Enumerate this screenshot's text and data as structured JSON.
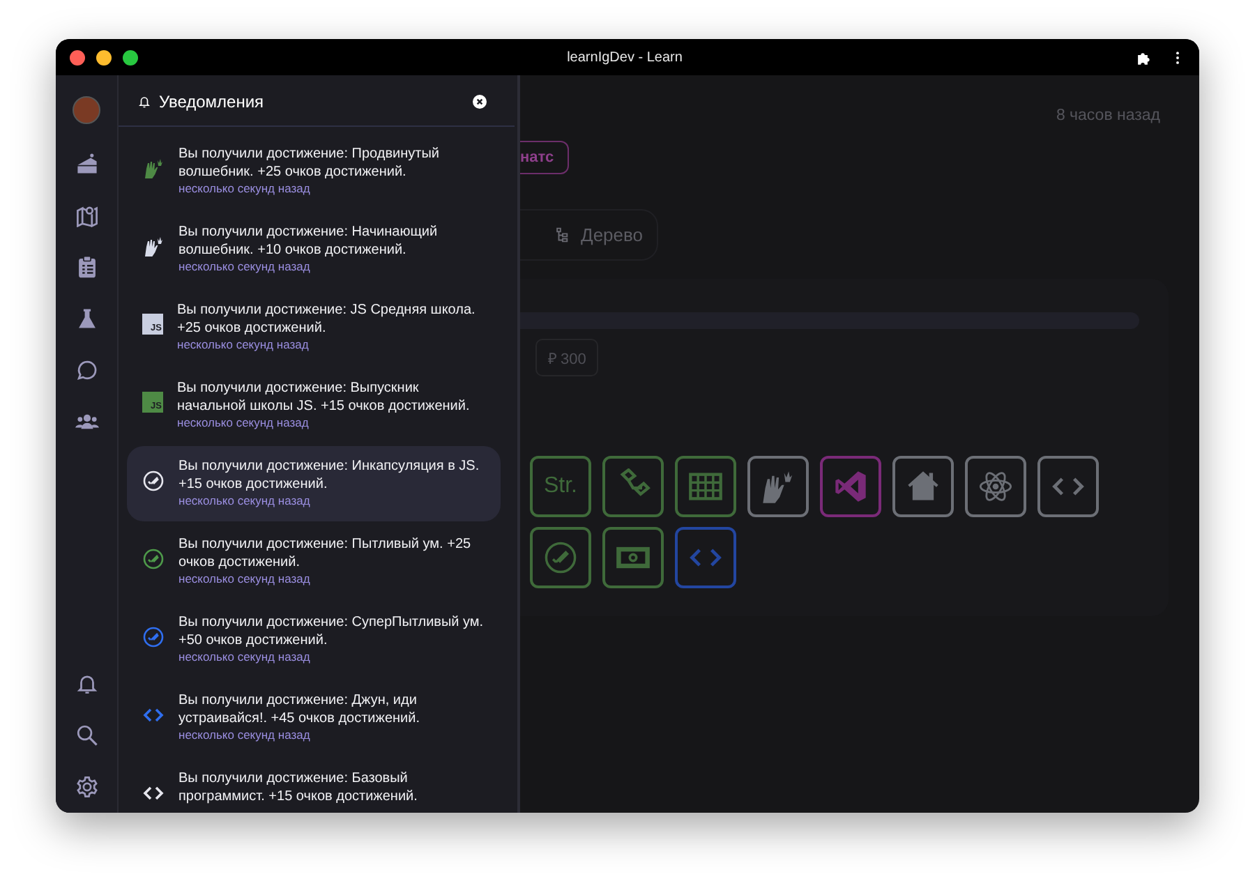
{
  "window": {
    "title": "learnIgDev - Learn"
  },
  "notifications": {
    "title": "Уведомления",
    "items": [
      {
        "kind": "hand",
        "color": "#4e8a45",
        "text": "Вы получили достижение: Продвинутый волшебник. +25 очков достижений.",
        "time": "несколько секунд назад",
        "selected": false
      },
      {
        "kind": "hand",
        "color": "#d8dcea",
        "text": "Вы получили достижение: Начинающий волшебник. +10 очков достижений.",
        "time": "несколько секунд назад",
        "selected": false
      },
      {
        "kind": "logo",
        "logo": "JS",
        "color": "#c9cee0",
        "text": "Вы получили достижение: JS Средняя школа. +25 очков достижений.",
        "time": "несколько секунд назад",
        "selected": false
      },
      {
        "kind": "logo",
        "logo": "JS",
        "color": "#4e8a45",
        "text": "Вы получили достижение: Выпускник начальной школы JS. +15 очков достижений.",
        "time": "несколько секунд назад",
        "selected": false
      },
      {
        "kind": "check",
        "color": "#e6e6ee",
        "text": "Вы получили достижение: Инкапсуляция в JS. +15 очков достижений.",
        "time": "несколько секунд назад",
        "selected": true
      },
      {
        "kind": "check",
        "color": "#4e9a4a",
        "text": "Вы получили достижение: Пытливый ум. +25 очков достижений.",
        "time": "несколько секунд назад",
        "selected": false
      },
      {
        "kind": "check",
        "color": "#2f6ef0",
        "text": "Вы получили достижение: СуперПытливый ум. +50 очков достижений.",
        "time": "несколько секунд назад",
        "selected": false
      },
      {
        "kind": "code",
        "color": "#2f6ef0",
        "text": "Вы получили достижение: Джун, иди устраивайся!. +45 очков достижений.",
        "time": "несколько секунд назад",
        "selected": false
      },
      {
        "kind": "code",
        "color": "#e6e6ee",
        "text": "Вы получили достижение: Базовый программист. +15 очков достижений.",
        "selected": false
      }
    ]
  },
  "main": {
    "time": "8 часов назад",
    "button": "натс",
    "tab": "Дерево",
    "chip": "₽ 300",
    "tiles": [
      {
        "kind": "text",
        "text": "Str.",
        "color": "#3f6a3a"
      },
      {
        "kind": "fork",
        "color": "#3f6a3a"
      },
      {
        "kind": "grid",
        "color": "#3f6a3a"
      },
      {
        "kind": "hand",
        "color": "#6c6f76"
      },
      {
        "kind": "vs",
        "color": "#7a2a78"
      },
      {
        "kind": "house",
        "color": "#6c6f76"
      },
      {
        "kind": "atom",
        "color": "#6c6f76"
      },
      {
        "kind": "code",
        "color": "#6c6f76"
      },
      {
        "kind": "check",
        "color": "#3f6a3a"
      },
      {
        "kind": "money",
        "color": "#3f6a3a"
      },
      {
        "kind": "code",
        "color": "#2346a0"
      }
    ]
  }
}
